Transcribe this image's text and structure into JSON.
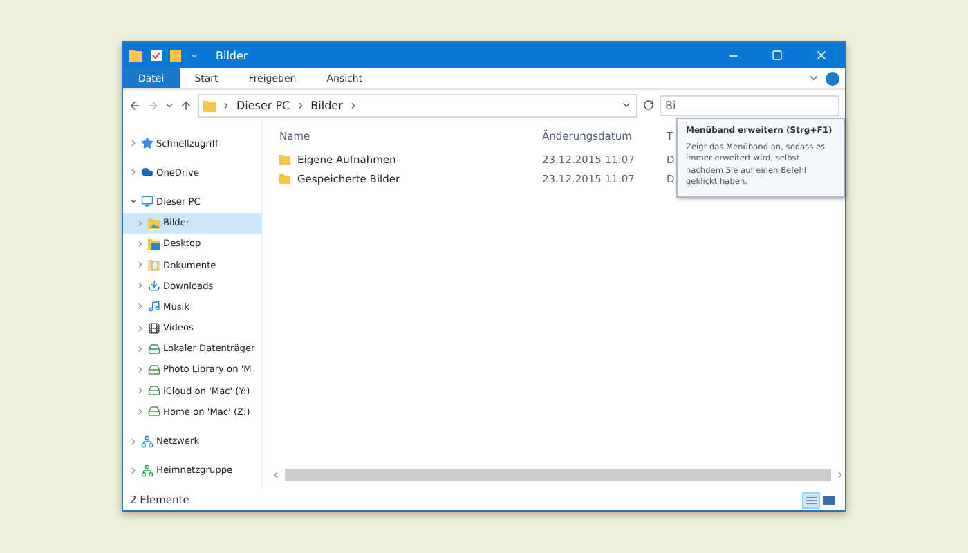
{
  "window": {
    "title": "Bilder"
  },
  "ribbon_tabs": [
    {
      "label": "Datei",
      "kind": "file"
    },
    {
      "label": "Start",
      "kind": "tab"
    },
    {
      "label": "Freigeben",
      "kind": "tab"
    },
    {
      "label": "Ansicht",
      "kind": "tab"
    }
  ],
  "address": {
    "path": [
      "Dieser PC",
      "Bilder"
    ],
    "search_value": "Bi"
  },
  "tooltip": {
    "title": "Menüband erweitern (Strg+F1)",
    "text": "Zeigt das Menüband an, sodass es immer erweitert wird, selbst nachdem Sie auf einen Befehl geklickt haben."
  },
  "sidebar": {
    "items": [
      {
        "label": "Schnellzugriff",
        "kind": "star",
        "expanded": false,
        "selected": false
      },
      {
        "label": "OneDrive",
        "kind": "cloud",
        "expanded": false,
        "selected": false
      },
      {
        "label": "Dieser PC",
        "kind": "pc",
        "expanded": true,
        "selected": false,
        "children": [
          {
            "label": "Bilder",
            "kind": "pictures",
            "expanded": false,
            "selected": true
          },
          {
            "label": "Desktop",
            "kind": "desktop",
            "expanded": false,
            "selected": false
          },
          {
            "label": "Dokumente",
            "kind": "documents",
            "expanded": false,
            "selected": false
          },
          {
            "label": "Downloads",
            "kind": "downloads",
            "expanded": false,
            "selected": false
          },
          {
            "label": "Musik",
            "kind": "music",
            "expanded": false,
            "selected": false
          },
          {
            "label": "Videos",
            "kind": "videos",
            "expanded": false,
            "selected": false
          },
          {
            "label": "Lokaler Datenträger",
            "kind": "disk",
            "expanded": false,
            "selected": false
          },
          {
            "label": "Photo Library on 'M",
            "kind": "netdrive",
            "expanded": false,
            "selected": false
          },
          {
            "label": "iCloud on 'Mac' (Y:)",
            "kind": "netdrive",
            "expanded": false,
            "selected": false
          },
          {
            "label": "Home on 'Mac' (Z:)",
            "kind": "netdrive",
            "expanded": false,
            "selected": false
          }
        ]
      },
      {
        "label": "Netzwerk",
        "kind": "network",
        "expanded": false,
        "selected": false
      },
      {
        "label": "Heimnetzgruppe",
        "kind": "homegroup",
        "expanded": false,
        "selected": false
      }
    ]
  },
  "table": {
    "columns": [
      "Name",
      "Änderungsdatum",
      "T"
    ],
    "rows": [
      {
        "name": "Eigene Aufnahmen",
        "date": "23.12.2015 11:07",
        "column_3": "D"
      },
      {
        "name": "Gespeicherte Bilder",
        "date": "23.12.2015 11:07",
        "column_3": "D"
      }
    ]
  },
  "status_bar": {
    "text": "2 Elemente"
  }
}
